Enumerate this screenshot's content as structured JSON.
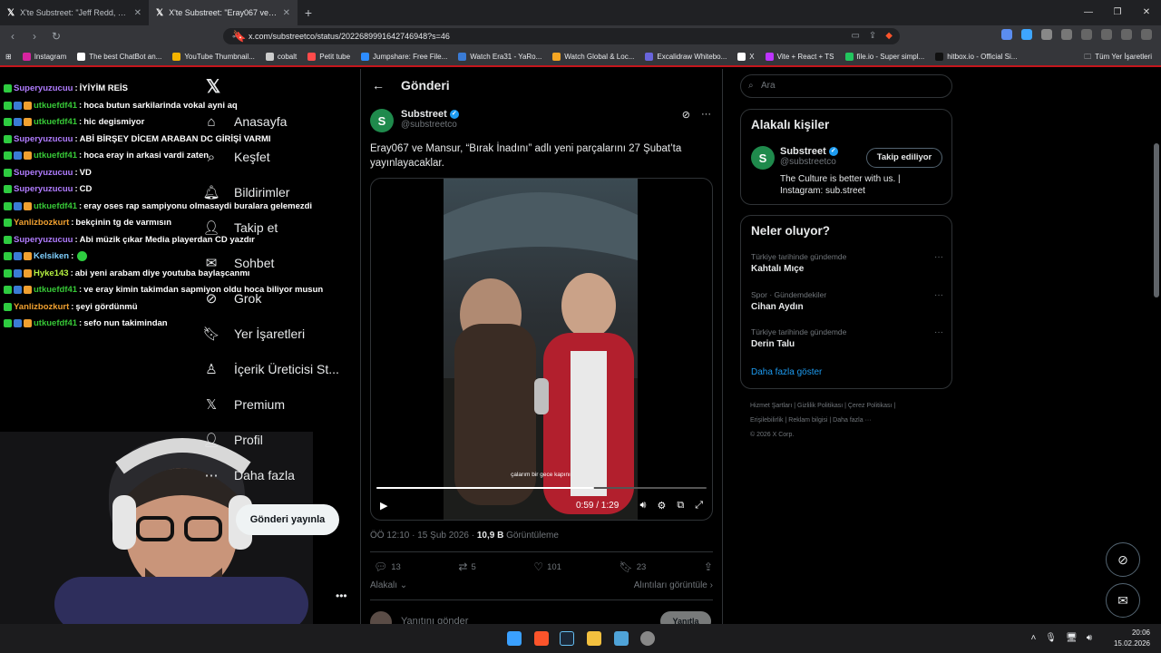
{
  "browser": {
    "tabs": [
      {
        "title": "X'te Substreet: \"Jeff Redd, \"Ben Bir B",
        "active": false
      },
      {
        "title": "X'te Substreet: \"Eray067 ve Man",
        "active": true
      }
    ],
    "url": "x.com/substreetco/status/2022689991642746948?s=46",
    "bookmarks": [
      {
        "label": "Instagram",
        "color": "#d6249f"
      },
      {
        "label": "The best ChatBot an...",
        "color": "#ffffff"
      },
      {
        "label": "YouTube Thumbnail...",
        "color": "#f4b400"
      },
      {
        "label": "cobalt",
        "color": "#cccccc"
      },
      {
        "label": "Petit tube",
        "color": "#ff4b4b"
      },
      {
        "label": "Jumpshare: Free File...",
        "color": "#2d8cff"
      },
      {
        "label": "Watch Era31 - YaRo...",
        "color": "#3a7bd5"
      },
      {
        "label": "Watch Global & Loc...",
        "color": "#f5a623"
      },
      {
        "label": "Excalidraw Whitebo...",
        "color": "#6965db"
      },
      {
        "label": "X",
        "color": "#ffffff"
      },
      {
        "label": "Vite + React + TS",
        "color": "#bd34fe"
      },
      {
        "label": "file.io - Super simpl...",
        "color": "#22c55e"
      },
      {
        "label": "hitbox.io - Official Si...",
        "color": "#111111"
      }
    ],
    "bookmarks_all": "Tüm Yer İşaretleri"
  },
  "chat": [
    {
      "user": "Superyuzucuu",
      "color": "#b07cff",
      "msg": "İYİYİM REİS"
    },
    {
      "user": "utkuefdf41",
      "color": "#37c837",
      "msg": "hoca butun sarkilarinda vokal ayni aq"
    },
    {
      "user": "utkuefdf41",
      "color": "#37c837",
      "msg": "hic degismiyor"
    },
    {
      "user": "Superyuzucuu",
      "color": "#b07cff",
      "msg": "ABİ BİRŞEY DİCEM ARABAN DC GİRİŞİ VARMI"
    },
    {
      "user": "utkuefdf41",
      "color": "#37c837",
      "msg": "hoca eray in arkasi vardi zaten"
    },
    {
      "user": "Superyuzucuu",
      "color": "#b07cff",
      "msg": "VD"
    },
    {
      "user": "Superyuzucuu",
      "color": "#b07cff",
      "msg": "CD"
    },
    {
      "user": "utkuefdf41",
      "color": "#37c837",
      "msg": "eray oses rap sampiyonu olmasaydi buralara gelemezdi"
    },
    {
      "user": "Yanlizbozkurt",
      "color": "#f0a030",
      "msg": "bekçinin tg de varmısın"
    },
    {
      "user": "Superyuzucuu",
      "color": "#b07cff",
      "msg": "Abi müzik çıkar Media playerdan CD yazdır"
    },
    {
      "user": "Kelsiken",
      "color": "#7fd0ff",
      "msg": ""
    },
    {
      "user": "Hyke143",
      "color": "#b5f041",
      "msg": "abi yeni arabam diye youtuba baylaşcanmı"
    },
    {
      "user": "utkuefdf41",
      "color": "#37c837",
      "msg": "ve eray kimin takimdan sapmiyon oldu hoca biliyor musun"
    },
    {
      "user": "Yanlizbozkurt",
      "color": "#f0a030",
      "msg": "şeyi gördünmü"
    },
    {
      "user": "utkuefdf41",
      "color": "#37c837",
      "msg": "sefo nun takimindan"
    }
  ],
  "nav": {
    "items": [
      "Anasayfa",
      "Keşfet",
      "Bildirimler",
      "Takip et",
      "Sohbet",
      "Grok",
      "Yer İşaretleri",
      "İçerik Üreticisi St...",
      "Premium",
      "Profil",
      "Daha fazla"
    ],
    "post_button": "Gönderi yayınla"
  },
  "post": {
    "header": "Gönderi",
    "author_name": "Substreet",
    "author_handle": "@substreetco",
    "avatar_letter": "S",
    "text": "Eray067 ve Mansur, “Bırak İnadını” adlı yeni parçalarını 27 Şubat’ta yayınlayacaklar.",
    "video": {
      "subtitle": "çalarım bir gece kapını",
      "time": "0:59 / 1:29",
      "progress": 0.66
    },
    "meta_time": "ÖÖ 12:10 · 15 Şub 2026 ·",
    "views": "10,9 B",
    "views_label": "Görüntüleme",
    "stats": {
      "replies": "13",
      "reposts": "5",
      "likes": "101",
      "bookmarks": "23"
    },
    "related_label": "Alakalı",
    "quotes_label": "Alıntıları görüntüle",
    "reply_placeholder": "Yanıtını gönder",
    "reply_button": "Yanıtla"
  },
  "sidebar": {
    "search_placeholder": "Ara",
    "relevant_title": "Alakalı kişiler",
    "person": {
      "name": "Substreet",
      "handle": "@substreetco",
      "bio": "The Culture is better with us. | Instagram: sub.street",
      "follow_label": "Takip ediliyor"
    },
    "trends_title": "Neler oluyor?",
    "trends": [
      {
        "category": "Türkiye tarihinde gündemde",
        "name": "Kahtalı Mıçe"
      },
      {
        "category": "Spor · Gündemdekiler",
        "name": "Cihan Aydın"
      },
      {
        "category": "Türkiye tarihinde gündemde",
        "name": "Derin Talu"
      }
    ],
    "show_more": "Daha fazla göster",
    "footer_line1": "Hizmet Şartları  |  Gizlilik Politikası  |  Çerez Politikası  |",
    "footer_line2": "Erişilebilirlik  |  Reklam bilgisi  |  Daha fazla ···",
    "footer_line3": "© 2026 X Corp."
  },
  "taskbar": {
    "time": "20:06",
    "date": "15.02.2026"
  }
}
